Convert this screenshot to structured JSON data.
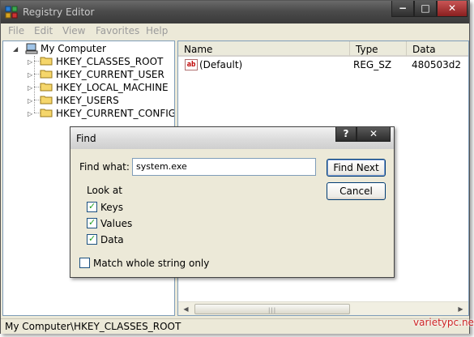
{
  "window": {
    "title": "Registry Editor",
    "min_glyph": "−",
    "max_glyph": "□",
    "close_glyph": "✕"
  },
  "menu": [
    "File",
    "Edit",
    "View",
    "Favorites",
    "Help"
  ],
  "tree": {
    "root": "My Computer",
    "hives": [
      "HKEY_CLASSES_ROOT",
      "HKEY_CURRENT_USER",
      "HKEY_LOCAL_MACHINE",
      "HKEY_USERS",
      "HKEY_CURRENT_CONFIG"
    ]
  },
  "list": {
    "columns": [
      "Name",
      "Type",
      "Data"
    ],
    "rows": [
      {
        "name": "(Default)",
        "type": "REG_SZ",
        "data": "480503d2"
      }
    ],
    "icon_text": "ab"
  },
  "status": "My Computer\\HKEY_CLASSES_ROOT",
  "watermark": "varietypc.net",
  "find_dialog": {
    "title": "Find",
    "help_glyph": "?",
    "close_glyph": "✕",
    "find_what_label": "Find what:",
    "find_what_value": "system.exe",
    "find_next_label": "Find Next",
    "cancel_label": "Cancel",
    "look_at_label": "Look at",
    "options": [
      {
        "label": "Keys",
        "checked": true
      },
      {
        "label": "Values",
        "checked": true
      },
      {
        "label": "Data",
        "checked": true
      }
    ],
    "match_label": "Match whole string only",
    "match_checked": false
  },
  "colors": {
    "accent_close": "#8a1f1f",
    "value_icon_red": "#c00000",
    "watermark": "#cc2222"
  }
}
